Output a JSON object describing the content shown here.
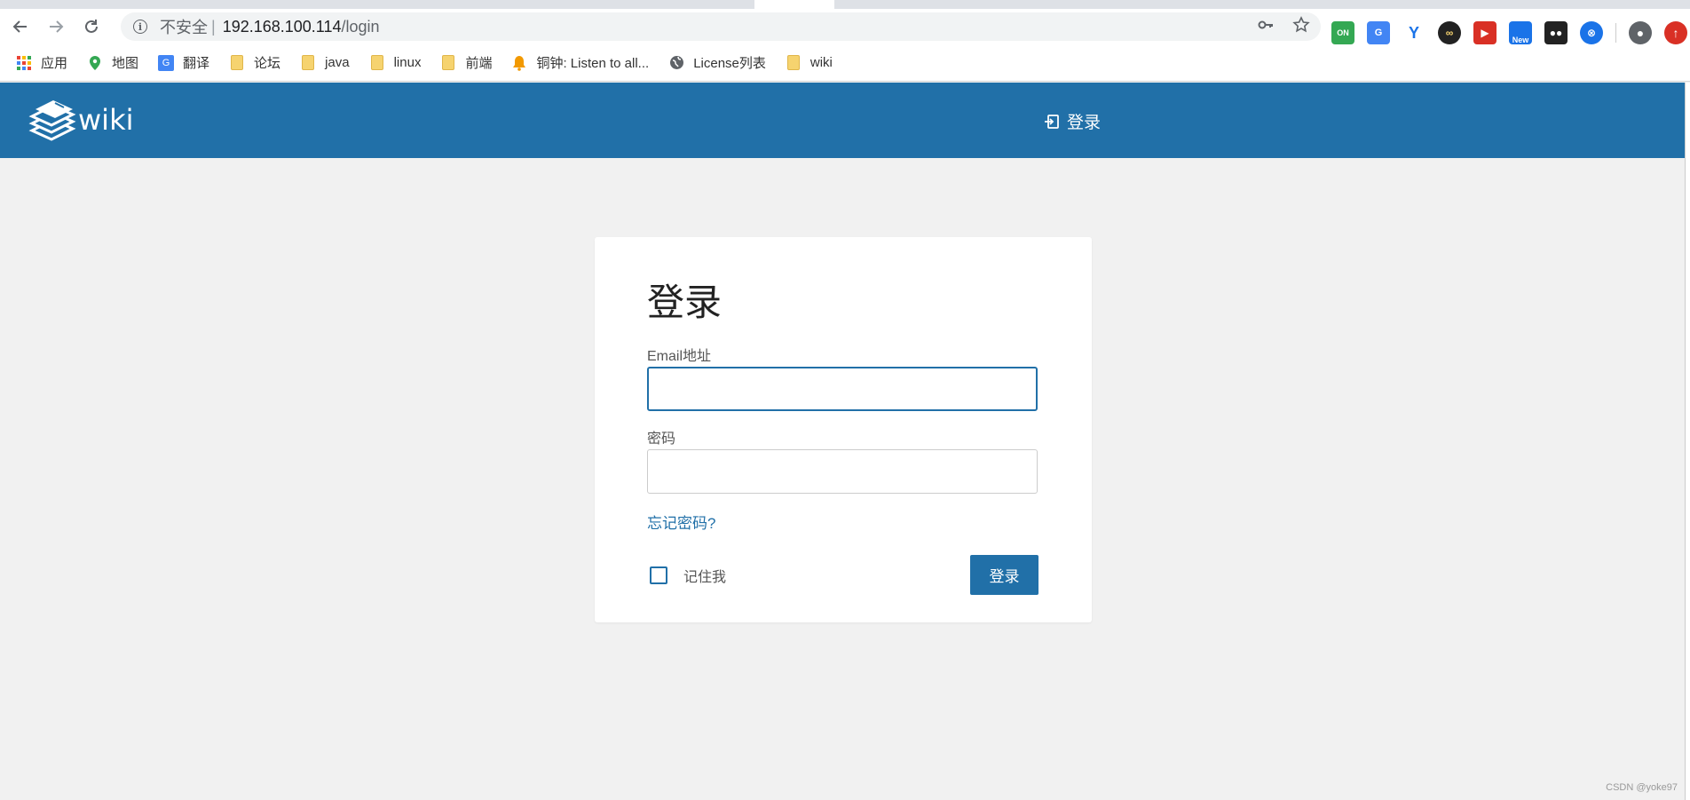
{
  "browser": {
    "security_label": "不安全",
    "separator": "|",
    "url_host": "192.168.100.114",
    "url_path": "/login",
    "extensions": [
      {
        "name": "ON",
        "color": "#34a853"
      },
      {
        "name": "translate",
        "color": "#4285f4"
      },
      {
        "name": "Y",
        "color": "#1a73e8"
      },
      {
        "name": "infinity",
        "color": "#222222"
      },
      {
        "name": "forward",
        "color": "#d93025"
      },
      {
        "name": "New",
        "color": "#1a73e8"
      },
      {
        "name": "tampermonkey",
        "color": "#222222"
      },
      {
        "name": "blue-circle",
        "color": "#1a73e8"
      }
    ],
    "ext_new_label": "New",
    "ext_on_label": "ON"
  },
  "bookmarks": [
    {
      "label": "应用",
      "icon": "apps-icon"
    },
    {
      "label": "地图",
      "icon": "maps-icon"
    },
    {
      "label": "翻译",
      "icon": "translate-icon"
    },
    {
      "label": "论坛",
      "icon": "folder-icon"
    },
    {
      "label": "java",
      "icon": "folder-icon"
    },
    {
      "label": "linux",
      "icon": "folder-icon"
    },
    {
      "label": "前端",
      "icon": "folder-icon"
    },
    {
      "label": "铜钟: Listen to all...",
      "icon": "bell-icon"
    },
    {
      "label": "License列表",
      "icon": "globe-icon"
    },
    {
      "label": "wiki",
      "icon": "folder-icon"
    }
  ],
  "header": {
    "logo_text": "wiki",
    "login_label": "登录",
    "color": "#2170a8"
  },
  "login_form": {
    "title": "登录",
    "email_label": "Email地址",
    "email_value": "",
    "password_label": "密码",
    "password_value": "",
    "forgot_label": "忘记密码?",
    "remember_label": "记住我",
    "remember_checked": false,
    "submit_label": "登录"
  },
  "watermark": "CSDN @yoke97"
}
